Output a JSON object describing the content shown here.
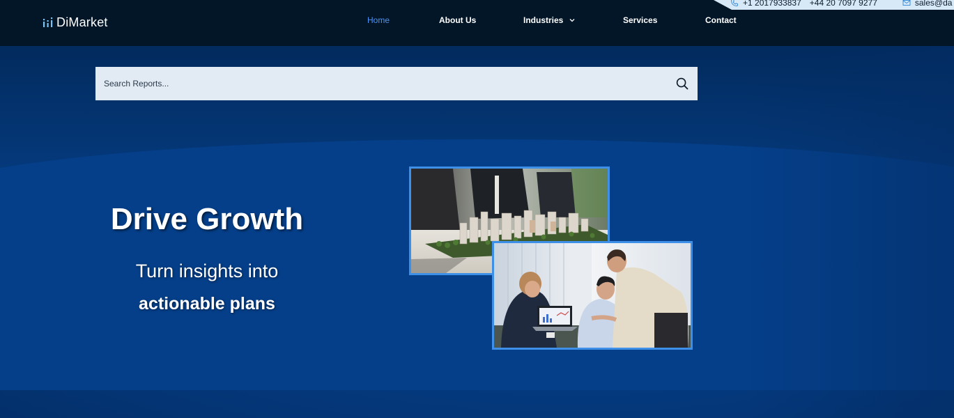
{
  "contact": {
    "phone_us": "+1 2017933837",
    "phone_uk": "+44 20 7097 9277",
    "email": "sales@da"
  },
  "header": {
    "logo_text": "DiMarket",
    "nav": [
      {
        "label": "Home",
        "active": true
      },
      {
        "label": "About Us",
        "active": false
      },
      {
        "label": "Industries",
        "active": false,
        "has_dropdown": true
      },
      {
        "label": "Services",
        "active": false
      },
      {
        "label": "Contact",
        "active": false
      }
    ]
  },
  "search": {
    "placeholder": "Search Reports...",
    "value": ""
  },
  "hero": {
    "headline": "Drive Growth",
    "subline1": "Turn insights into",
    "subline2": "actionable plans",
    "images": [
      {
        "icon": "city-model-meeting-photo"
      },
      {
        "icon": "team-laptop-analytics-photo"
      }
    ]
  },
  "colors": {
    "header_bg": "#021628",
    "hero_bg": "#053f89",
    "accent": "#4c94f5",
    "photo_border": "#3d8fe8",
    "search_bg": "#e2ebf4"
  }
}
